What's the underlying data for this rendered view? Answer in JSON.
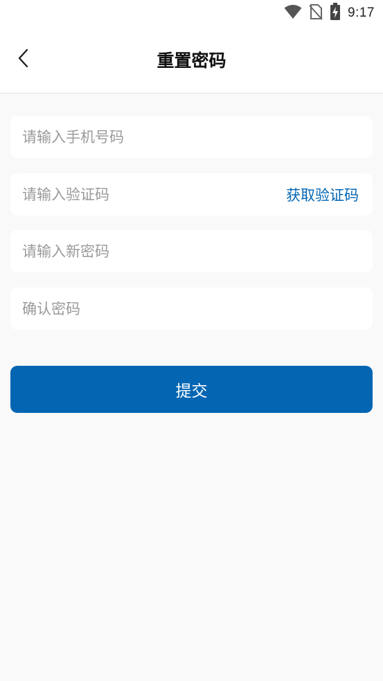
{
  "status_bar": {
    "time": "9:17",
    "icons": [
      "wifi-icon",
      "no-sim-icon",
      "battery-charging-icon"
    ]
  },
  "header": {
    "title": "重置密码",
    "back_icon": "chevron-left-icon"
  },
  "form": {
    "phone": {
      "value": "",
      "placeholder": "请输入手机号码"
    },
    "code": {
      "value": "",
      "placeholder": "请输入验证码",
      "action_label": "获取验证码"
    },
    "new_password": {
      "value": "",
      "placeholder": "请输入新密码"
    },
    "confirm_password": {
      "value": "",
      "placeholder": "确认密码"
    },
    "submit_label": "提交"
  },
  "colors": {
    "accent": "#0466b3",
    "background": "#f9f9f9",
    "surface": "#ffffff",
    "placeholder": "#9a9a9a"
  }
}
